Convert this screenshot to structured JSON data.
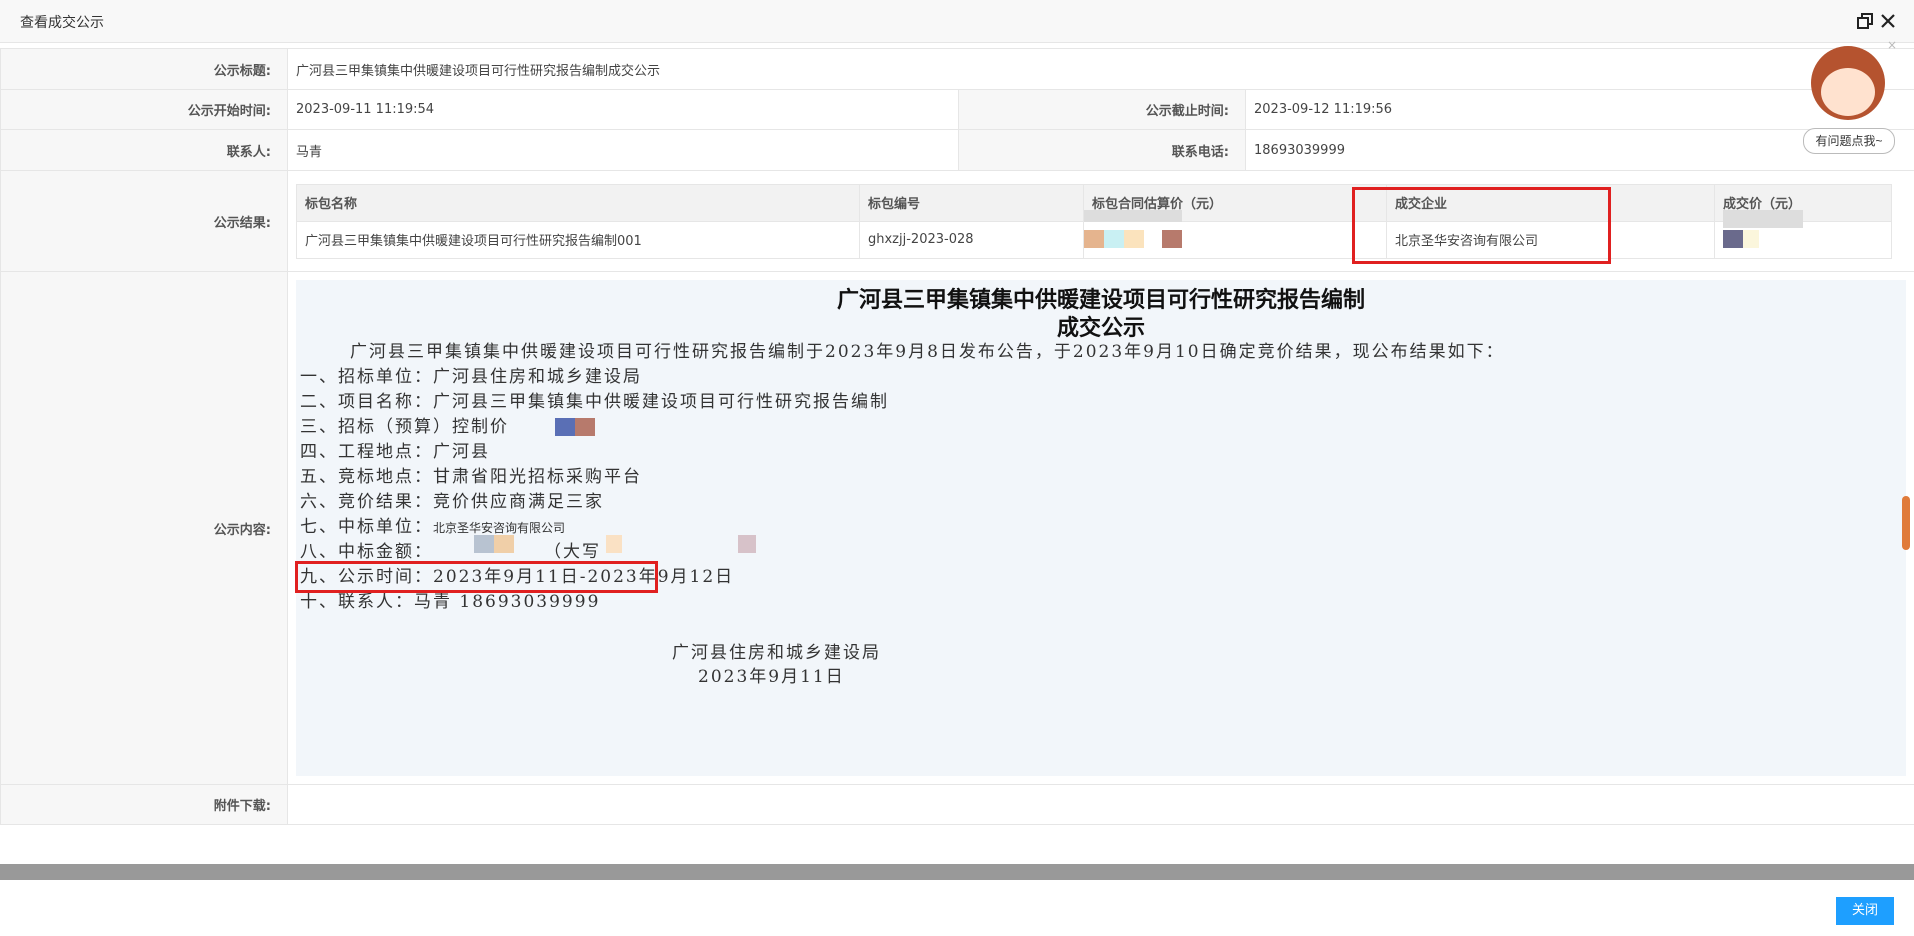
{
  "window": {
    "title": "查看成交公示"
  },
  "form": {
    "title_label": "公示标题:",
    "title_value": "广河县三甲集镇集中供暖建设项目可行性研究报告编制成交公示",
    "start_label": "公示开始时间:",
    "start_value": "2023-09-11 11:19:54",
    "end_label": "公示截止时间:",
    "end_value": "2023-09-12 11:19:56",
    "contact_label": "联系人:",
    "contact_value": "马青",
    "phone_label": "联系电话:",
    "phone_value": "18693039999",
    "result_label": "公示结果:",
    "content_label": "公示内容:",
    "attachment_label": "附件下载:"
  },
  "result_table": {
    "headers": [
      "标包名称",
      "标包编号",
      "标包合同估算价（元）",
      "成交企业",
      "成交价（元）"
    ],
    "rows": [
      {
        "name": "广河县三甲集镇集中供暖建设项目可行性研究报告编制001",
        "code": "ghxzjj-2023-028",
        "company": "北京圣华安咨询有限公司"
      }
    ]
  },
  "document": {
    "title_line1": "广河县三甲集镇集中供暖建设项目可行性研究报告编制",
    "title_line2": "成交公示",
    "intro": "广河县三甲集镇集中供暖建设项目可行性研究报告编制于2023年9月8日发布公告，于2023年9月10日确定竞价结果，现公布结果如下：",
    "item1": "一、招标单位：广河县住房和城乡建设局",
    "item2": "二、项目名称：广河县三甲集镇集中供暖建设项目可行性研究报告编制",
    "item3": "三、招标（预算）控制价",
    "item4": "四、工程地点：广河县",
    "item5": "五、竞标地点：甘肃省阳光招标采购平台",
    "item6": "六、竞价结果：竞价供应商满足三家",
    "item7_prefix": "七、中标单位：",
    "item7_company": "北京圣华安咨询有限公司",
    "item8_prefix": "八、中标金额：",
    "item8_daxie": "（大写",
    "item9": "九、公示时间：2023年9月11日-2023年9月12日",
    "item10": "十、联系人：马青     18693039999",
    "sign_org": "广河县住房和城乡建设局",
    "sign_date": "2023年9月11日"
  },
  "helper": {
    "bubble_text": "有问题点我~",
    "close": "×"
  },
  "footer": {
    "close_button": "关闭"
  },
  "colors": {
    "accent": "#1e9fff",
    "highlight_box": "#e02020"
  }
}
